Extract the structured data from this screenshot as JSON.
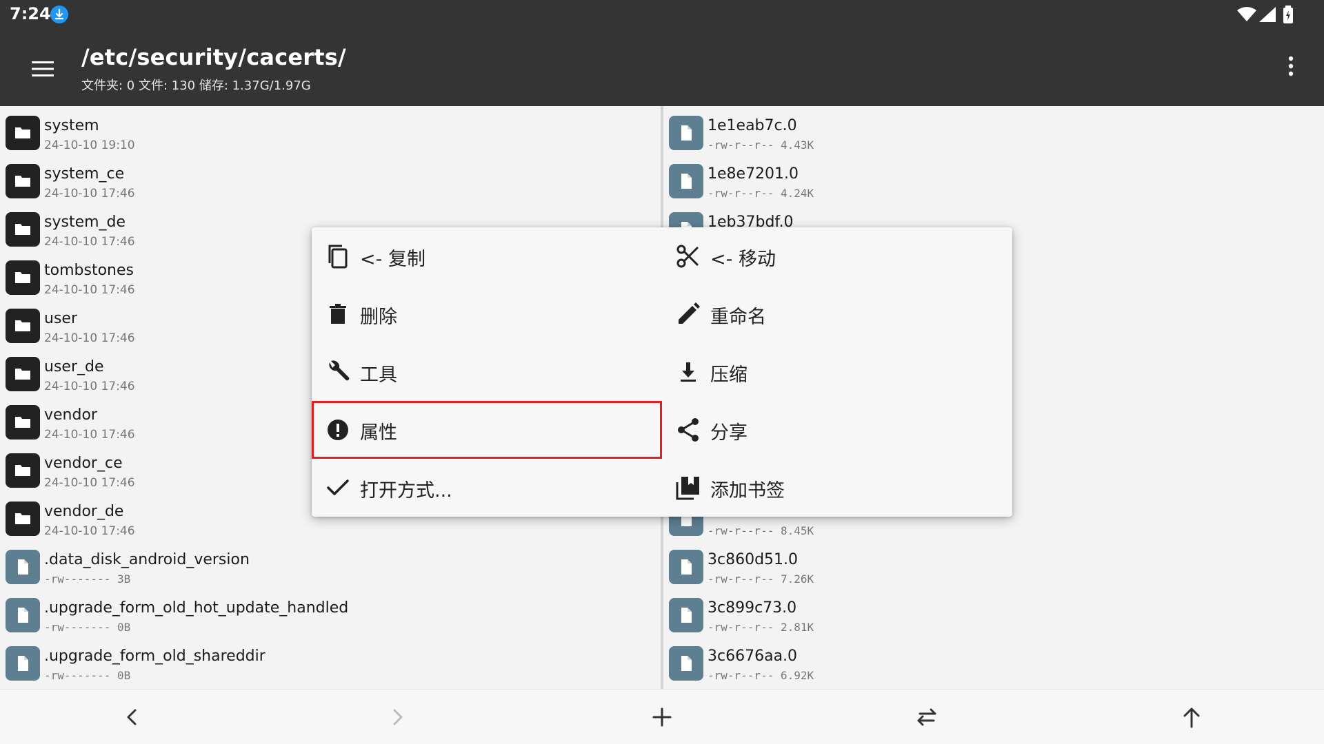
{
  "status_bar": {
    "time": "7:24"
  },
  "toolbar": {
    "path": "/etc/security/cacerts/",
    "summary": "文件夹: 0  文件: 130  储存: 1.37G/1.97G"
  },
  "left_pane": {
    "items": [
      {
        "type": "folder",
        "name": "system",
        "meta": "24-10-10 19:10"
      },
      {
        "type": "folder",
        "name": "system_ce",
        "meta": "24-10-10 17:46"
      },
      {
        "type": "folder",
        "name": "system_de",
        "meta": "24-10-10 17:46"
      },
      {
        "type": "folder",
        "name": "tombstones",
        "meta": "24-10-10 17:46"
      },
      {
        "type": "folder",
        "name": "user",
        "meta": "24-10-10 17:46"
      },
      {
        "type": "folder",
        "name": "user_de",
        "meta": "24-10-10 17:46"
      },
      {
        "type": "folder",
        "name": "vendor",
        "meta": "24-10-10 17:46"
      },
      {
        "type": "folder",
        "name": "vendor_ce",
        "meta": "24-10-10 17:46"
      },
      {
        "type": "folder",
        "name": "vendor_de",
        "meta": "24-10-10 17:46"
      },
      {
        "type": "file",
        "name": ".data_disk_android_version",
        "meta": "-rw-------  3B"
      },
      {
        "type": "file",
        "name": ".upgrade_form_old_hot_update_handled",
        "meta": "-rw-------  0B"
      },
      {
        "type": "file",
        "name": ".upgrade_form_old_shareddir",
        "meta": "-rw-------  0B"
      }
    ]
  },
  "right_pane": {
    "items": [
      {
        "type": "file",
        "name": "1e1eab7c.0",
        "meta": "-rw-r--r--  4.43K"
      },
      {
        "type": "file",
        "name": "1e8e7201.0",
        "meta": "-rw-r--r--  4.24K"
      },
      {
        "type": "file",
        "name": "1eb37bdf.0",
        "meta": ""
      },
      {
        "type": "file",
        "name": "",
        "meta": "-rw-r--r--  8.45K"
      },
      {
        "type": "file",
        "name": "3c860d51.0",
        "meta": "-rw-r--r--  7.26K"
      },
      {
        "type": "file",
        "name": "3c899c73.0",
        "meta": "-rw-r--r--  2.81K"
      },
      {
        "type": "file",
        "name": "3c6676aa.0",
        "meta": "-rw-r--r--  6.92K"
      }
    ]
  },
  "context_menu": {
    "items": [
      {
        "label": "<- 复制",
        "icon": "copy-icon"
      },
      {
        "label": "<- 移动",
        "icon": "scissors-icon"
      },
      {
        "label": "删除",
        "icon": "trash-icon"
      },
      {
        "label": "重命名",
        "icon": "pencil-icon"
      },
      {
        "label": "工具",
        "icon": "wrench-icon"
      },
      {
        "label": "压缩",
        "icon": "download-icon"
      },
      {
        "label": "属性",
        "icon": "info-icon",
        "highlighted": true
      },
      {
        "label": "分享",
        "icon": "share-icon"
      },
      {
        "label": "打开方式...",
        "icon": "check-icon"
      },
      {
        "label": "添加书签",
        "icon": "bookmark-icon"
      }
    ]
  },
  "bottom_bar": {
    "buttons": [
      "back",
      "forward",
      "add",
      "swap",
      "up"
    ]
  },
  "colors": {
    "toolbar_bg": "#343434",
    "file_icon": "#5e7f92",
    "folder_icon": "#222222",
    "highlight": "#e02020",
    "status_download": "#2196f3"
  }
}
